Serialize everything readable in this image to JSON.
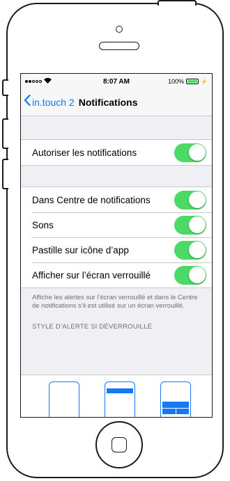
{
  "status_bar": {
    "carrier_signal": "●●○○○",
    "time": "8:07 AM",
    "battery_percent": "100%"
  },
  "nav": {
    "back_label": "in.touch 2",
    "title": "Notifications"
  },
  "groups": [
    {
      "rows": [
        {
          "label": "Autoriser les notifications",
          "on": true
        }
      ]
    },
    {
      "rows": [
        {
          "label": "Dans Centre de notifications",
          "on": true
        },
        {
          "label": "Sons",
          "on": true
        },
        {
          "label": "Pastille sur icône d’app",
          "on": true
        },
        {
          "label": "Afficher sur l’écran verrouillé",
          "on": true
        }
      ]
    }
  ],
  "footer_text": "Affiche les alertes sur l’écran verrouillé et dans le Centre de notifications s’il est utilisé sur un écran verrouillé.",
  "alert_style_header": "STYLE D’ALERTE SI DÉVERROUILLÉ",
  "colors": {
    "toggle_on": "#4cd964",
    "tint": "#007aff",
    "preview_blue": "#1878f3"
  }
}
